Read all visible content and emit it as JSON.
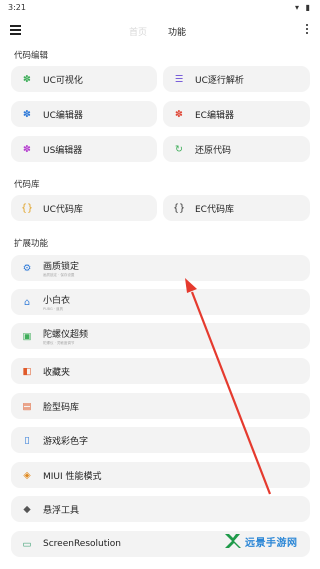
{
  "status_bar": {
    "time": "3:21"
  },
  "app_bar": {
    "tabs": [
      "首页",
      "功能"
    ]
  },
  "sections": {
    "code_editor": "代码编辑",
    "code_library": "代码库",
    "extensions": "扩展功能"
  },
  "code_editor_items": [
    {
      "label": "UC可视化",
      "icon": "puzzle-icon",
      "color": "#3fae5a"
    },
    {
      "label": "UC逐行解析",
      "icon": "list-icon",
      "color": "#6a4bd6"
    },
    {
      "label": "UC编辑器",
      "icon": "puzzle-icon",
      "color": "#2f7ad8"
    },
    {
      "label": "EC编辑器",
      "icon": "puzzle-icon",
      "color": "#e04a3a"
    },
    {
      "label": "US编辑器",
      "icon": "puzzle-icon",
      "color": "#b63fd0"
    },
    {
      "label": "还原代码",
      "icon": "restore-icon",
      "color": "#3fae5a"
    }
  ],
  "code_library_items": [
    {
      "label": "UC代码库",
      "icon": "braces-icon",
      "color": "#e0a020"
    },
    {
      "label": "EC代码库",
      "icon": "braces-icon",
      "color": "#333333"
    }
  ],
  "extension_items": [
    {
      "label": "画质锁定",
      "sub": "画质锁定 · 保存设置",
      "icon": "quality-icon",
      "color": "#2f7ad8"
    },
    {
      "label": "小白衣",
      "sub": "PUBG · 道具",
      "icon": "hanger-icon",
      "color": "#2f7ad8"
    },
    {
      "label": "陀螺仪超频",
      "sub": "陀螺仪 · 灵敏度调节",
      "icon": "chip-icon",
      "color": "#3fae5a"
    },
    {
      "label": "收藏夹",
      "icon": "office-icon",
      "color": "#e05a2a"
    },
    {
      "label": "脸型码库",
      "icon": "face-icon",
      "color": "#e05a2a"
    },
    {
      "label": "游戏彩色字",
      "icon": "clipboard-icon",
      "color": "#2f7ad8"
    },
    {
      "label": "MIUI 性能模式",
      "icon": "performance-icon",
      "color": "#e08a20"
    },
    {
      "label": "悬浮工具",
      "icon": "layers-icon",
      "color": "#555555"
    },
    {
      "label": "ScreenResolution",
      "icon": "screen-icon",
      "color": "#2e9a6a"
    }
  ],
  "watermark": {
    "text": "远景手游网"
  },
  "colors": {
    "card_bg": "#f3f3f3",
    "arrow": "#e53a2e"
  }
}
